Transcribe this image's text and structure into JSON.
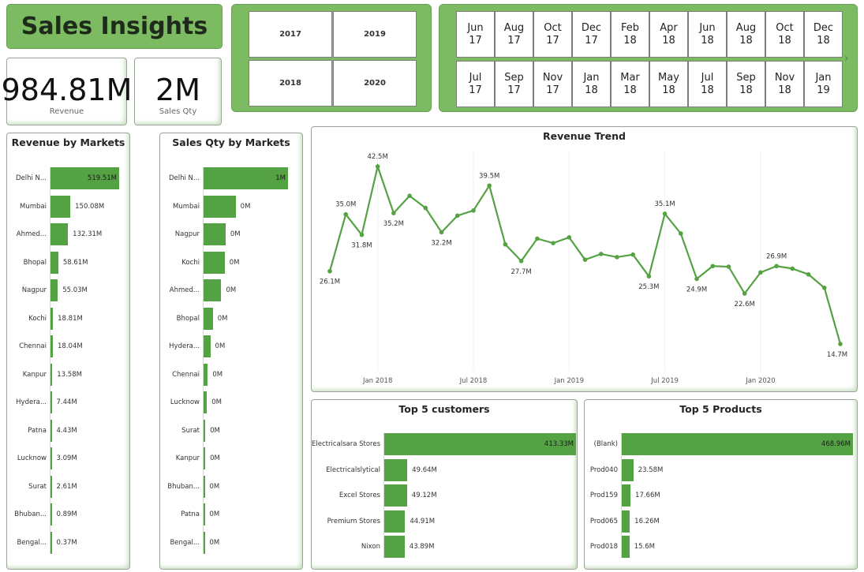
{
  "header": {
    "title": "Sales Insights"
  },
  "kpis": {
    "revenue": {
      "value": "984.81M",
      "label": "Revenue"
    },
    "qty": {
      "value": "2M",
      "label": "Sales Qty"
    }
  },
  "year_slicer": [
    "2017",
    "2019",
    "2018",
    "2020"
  ],
  "month_slicer": {
    "row1": [
      [
        "Jun",
        "17"
      ],
      [
        "Aug",
        "17"
      ],
      [
        "Oct",
        "17"
      ],
      [
        "Dec",
        "17"
      ],
      [
        "Feb",
        "18"
      ],
      [
        "Apr",
        "18"
      ],
      [
        "Jun",
        "18"
      ],
      [
        "Aug",
        "18"
      ],
      [
        "Oct",
        "18"
      ],
      [
        "Dec",
        "18"
      ]
    ],
    "row2": [
      [
        "Jul",
        "17"
      ],
      [
        "Sep",
        "17"
      ],
      [
        "Nov",
        "17"
      ],
      [
        "Jan",
        "18"
      ],
      [
        "Mar",
        "18"
      ],
      [
        "May",
        "18"
      ],
      [
        "Jul",
        "18"
      ],
      [
        "Sep",
        "18"
      ],
      [
        "Nov",
        "18"
      ],
      [
        "Jan",
        "19"
      ]
    ],
    "next_icon": "chevron-right-icon"
  },
  "colors": {
    "accent": "#54a243",
    "panel": "#7dbb63"
  },
  "chart_data": [
    {
      "type": "bar",
      "title": "Revenue by Markets",
      "categories": [
        "Delhi N...",
        "Mumbai",
        "Ahmed...",
        "Bhopal",
        "Nagpur",
        "Kochi",
        "Chennai",
        "Kanpur",
        "Hydera...",
        "Patna",
        "Lucknow",
        "Surat",
        "Bhuban...",
        "Bengal..."
      ],
      "values": [
        519.51,
        150.08,
        132.31,
        58.61,
        55.03,
        18.81,
        18.04,
        13.58,
        7.44,
        4.43,
        3.09,
        2.61,
        0.89,
        0.37
      ],
      "labels": [
        "519.51M",
        "150.08M",
        "132.31M",
        "58.61M",
        "55.03M",
        "18.81M",
        "18.04M",
        "13.58M",
        "7.44M",
        "4.43M",
        "3.09M",
        "2.61M",
        "0.89M",
        "0.37M"
      ]
    },
    {
      "type": "bar",
      "title": "Sales Qty by Markets",
      "categories": [
        "Delhi N...",
        "Mumbai",
        "Nagpur",
        "Kochi",
        "Ahmed...",
        "Bhopal",
        "Hydera...",
        "Chennai",
        "Lucknow",
        "Surat",
        "Kanpur",
        "Bhuban...",
        "Patna",
        "Bengal..."
      ],
      "values": [
        1.0,
        0.38,
        0.26,
        0.25,
        0.21,
        0.11,
        0.08,
        0.05,
        0.04,
        0.02,
        0.02,
        0.01,
        0.01,
        0.005
      ],
      "labels": [
        "1M",
        "0M",
        "0M",
        "0M",
        "0M",
        "0M",
        "0M",
        "0M",
        "0M",
        "0M",
        "0M",
        "0M",
        "0M",
        "0M"
      ]
    },
    {
      "type": "line",
      "title": "Revenue Trend",
      "x_ticks": [
        "Jan 2018",
        "Jul 2018",
        "Jan 2019",
        "Jul 2019",
        "Jan 2020"
      ],
      "x": [
        "2017-10",
        "2017-11",
        "2017-12",
        "2018-01",
        "2018-02",
        "2018-03",
        "2018-04",
        "2018-05",
        "2018-06",
        "2018-07",
        "2018-08",
        "2018-09",
        "2018-10",
        "2018-11",
        "2018-12",
        "2019-01",
        "2019-02",
        "2019-03",
        "2019-04",
        "2019-05",
        "2019-06",
        "2019-07",
        "2019-08",
        "2019-09",
        "2019-10",
        "2019-11",
        "2019-12",
        "2020-01",
        "2020-02",
        "2020-03",
        "2020-04",
        "2020-05",
        "2020-06"
      ],
      "values": [
        26.1,
        35.0,
        31.8,
        42.5,
        35.2,
        37.9,
        36.0,
        32.2,
        34.8,
        35.6,
        39.5,
        30.3,
        27.7,
        31.2,
        30.5,
        31.4,
        27.9,
        28.8,
        28.3,
        28.7,
        25.3,
        35.1,
        32.0,
        24.9,
        26.9,
        26.8,
        22.6,
        25.9,
        26.9,
        26.5,
        25.6,
        23.5,
        14.7
      ],
      "point_labels": {
        "0": "26.1M",
        "1": "35.0M",
        "2": "31.8M",
        "3": "42.5M",
        "4": "35.2M",
        "7": "32.2M",
        "10": "39.5M",
        "12": "27.7M",
        "20": "25.3M",
        "21": "35.1M",
        "23": "24.9M",
        "26": "22.6M",
        "28": "26.9M",
        "32": "14.7M"
      }
    },
    {
      "type": "bar",
      "title": "Top 5 customers",
      "categories": [
        "Electricalsara Stores",
        "Electricalslytical",
        "Excel Stores",
        "Premium Stores",
        "Nixon"
      ],
      "values": [
        413.33,
        49.64,
        49.12,
        44.91,
        43.89
      ],
      "labels": [
        "413.33M",
        "49.64M",
        "49.12M",
        "44.91M",
        "43.89M"
      ]
    },
    {
      "type": "bar",
      "title": "Top 5 Products",
      "categories": [
        "(Blank)",
        "Prod040",
        "Prod159",
        "Prod065",
        "Prod018"
      ],
      "values": [
        468.96,
        23.58,
        17.66,
        16.26,
        15.6
      ],
      "labels": [
        "468.96M",
        "23.58M",
        "17.66M",
        "16.26M",
        "15.6M"
      ]
    }
  ]
}
